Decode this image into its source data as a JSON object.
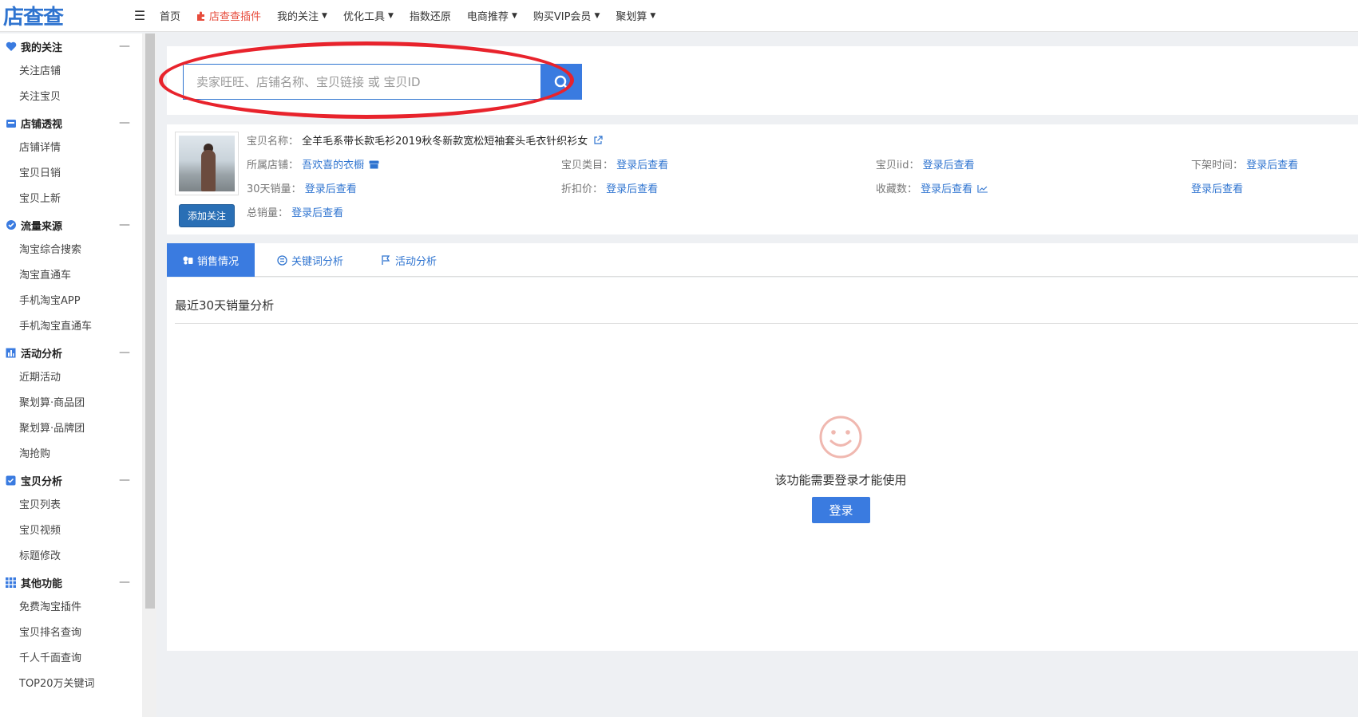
{
  "header": {
    "logo_text": "店查查",
    "menu_icon": "☰",
    "nav": [
      {
        "label": "首页"
      },
      {
        "label": "店查查插件"
      },
      {
        "label": "我的关注"
      },
      {
        "label": "优化工具"
      },
      {
        "label": "指数还原"
      },
      {
        "label": "电商推荐"
      },
      {
        "label": "购买VIP会员"
      },
      {
        "label": "聚划算"
      }
    ]
  },
  "sidebar": {
    "groups": [
      {
        "title": "我的关注",
        "items": [
          "关注店铺",
          "关注宝贝"
        ]
      },
      {
        "title": "店铺透视",
        "items": [
          "店铺详情",
          "宝贝日销",
          "宝贝上新"
        ]
      },
      {
        "title": "流量来源",
        "items": [
          "淘宝综合搜索",
          "淘宝直通车",
          "手机淘宝APP",
          "手机淘宝直通车"
        ]
      },
      {
        "title": "活动分析",
        "items": [
          "近期活动",
          "聚划算·商品团",
          "聚划算·品牌团",
          "淘抢购"
        ]
      },
      {
        "title": "宝贝分析",
        "items": [
          "宝贝列表",
          "宝贝视频",
          "标题修改"
        ]
      },
      {
        "title": "其他功能",
        "items": [
          "免费淘宝插件",
          "宝贝排名查询",
          "千人千面查询",
          "TOP20万关键词"
        ]
      }
    ],
    "collapse_symbol": "—"
  },
  "search": {
    "placeholder": "卖家旺旺、店铺名称、宝贝链接 或 宝贝ID"
  },
  "product": {
    "follow_label": "添加关注",
    "name_label": "宝贝名称：",
    "name_value": "全羊毛系带长款毛衫2019秋冬新款宽松短袖套头毛衣针织衫女",
    "shop_label": "所属店铺：",
    "shop_value": "吾欢喜的衣橱",
    "category_label": "宝贝类目：",
    "category_value": "登录后查看",
    "iid_label": "宝贝iid：",
    "iid_value": "登录后查看",
    "offtime_label": "下架时间：",
    "offtime_value": "登录后查看",
    "sales30_label": "30天销量：",
    "sales30_value": "登录后查看",
    "discount_label": "折扣价：",
    "discount_value": "登录后查看",
    "fav_label": "收藏数：",
    "fav_value": "登录后查看",
    "extra_value": "登录后查看",
    "total_label": "总销量：",
    "total_value": "登录后查看"
  },
  "tabs": [
    {
      "label": "销售情况"
    },
    {
      "label": "关键词分析"
    },
    {
      "label": "活动分析"
    }
  ],
  "content": {
    "section_title": "最近30天销量分析",
    "login_message": "该功能需要登录才能使用",
    "login_button": "登录"
  },
  "colors": {
    "accent": "#3a7be0",
    "link": "#2f74d0",
    "highlight_ellipse": "#e8232c",
    "plugin_red": "#e74c3c"
  }
}
